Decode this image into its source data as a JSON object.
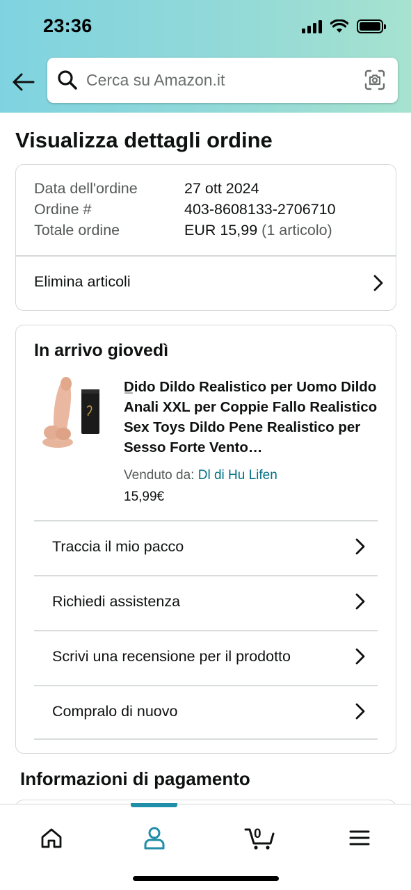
{
  "status_bar": {
    "time": "23:36"
  },
  "search": {
    "placeholder": "Cerca su Amazon.it"
  },
  "page": {
    "title": "Visualizza dettagli ordine"
  },
  "order_summary": {
    "rows": [
      {
        "label": "Data dell'ordine",
        "value": "27 ott 2024"
      },
      {
        "label": "Ordine #",
        "value": "403-8608133-2706710"
      },
      {
        "label": "Totale ordine",
        "value": "EUR 15,99",
        "value_extra": "(1 articolo)"
      }
    ],
    "action_label": "Elimina articoli"
  },
  "delivery": {
    "title": "In arrivo giovedì",
    "product": {
      "title": "D̲ido Dildo Realistico per Uomo Dildo Anali XXL per Coppie Fallo Realistico Sex Toys Dildo Pene Realistico per Sesso Forte Vento…",
      "sold_by_label": "Venduto da:",
      "seller": "Dl di Hu Lifen",
      "price": "15,99€"
    },
    "actions": [
      {
        "label": "Traccia il mio pacco"
      },
      {
        "label": "Richiedi assistenza"
      },
      {
        "label": "Scrivi una recensione per il prodotto"
      },
      {
        "label": "Compralo di nuovo"
      }
    ]
  },
  "payment": {
    "title": "Informazioni di pagamento"
  },
  "bottom_nav": {
    "items": [
      "home-icon",
      "account-icon",
      "cart-icon",
      "menu-icon"
    ],
    "active": "account-icon",
    "cart_count": "0"
  },
  "colors": {
    "accent": "#1f8ea8",
    "link": "#007185",
    "text": "#0f1111",
    "muted": "#565959",
    "border": "#d5d9d9"
  }
}
